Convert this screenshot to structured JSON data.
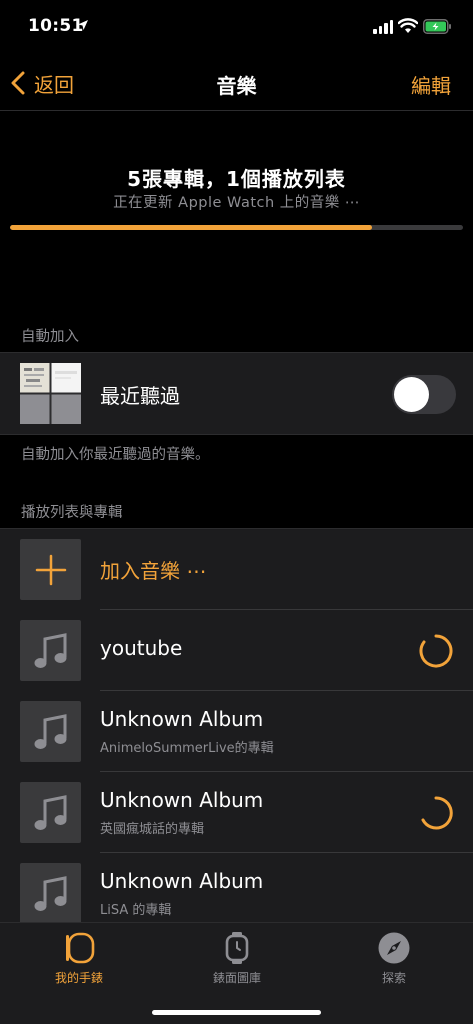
{
  "status": {
    "time": "10:51"
  },
  "nav": {
    "back_label": "返回",
    "title": "音樂",
    "edit_label": "編輯"
  },
  "sync": {
    "title": "5張專輯，1個播放列表",
    "subtitle": "正在更新 Apple Watch 上的音樂 ⋯",
    "progress": 0.8
  },
  "auto_add": {
    "header": "自動加入",
    "row_title": "最近聽過",
    "toggle_on": false,
    "footer": "自動加入你最近聽過的音樂。"
  },
  "library": {
    "header": "播放列表與專輯",
    "add_label": "加入音樂 ⋯",
    "items": [
      {
        "title": "youtube",
        "subtitle": ""
      },
      {
        "title": "Unknown Album",
        "subtitle": "AnimeloSummerLive的專輯"
      },
      {
        "title": "Unknown Album",
        "subtitle": "英國瘋城話的專輯"
      },
      {
        "title": "Unknown Album",
        "subtitle": "LiSA 的專輯"
      }
    ]
  },
  "tabs": [
    {
      "label": "我的手錶",
      "icon": "watch-icon"
    },
    {
      "label": "錶面圖庫",
      "icon": "watch-face-icon"
    },
    {
      "label": "探索",
      "icon": "compass-icon"
    }
  ],
  "colors": {
    "accent": "#f2a33a",
    "background": "#000000",
    "cell": "#1c1c1e"
  }
}
